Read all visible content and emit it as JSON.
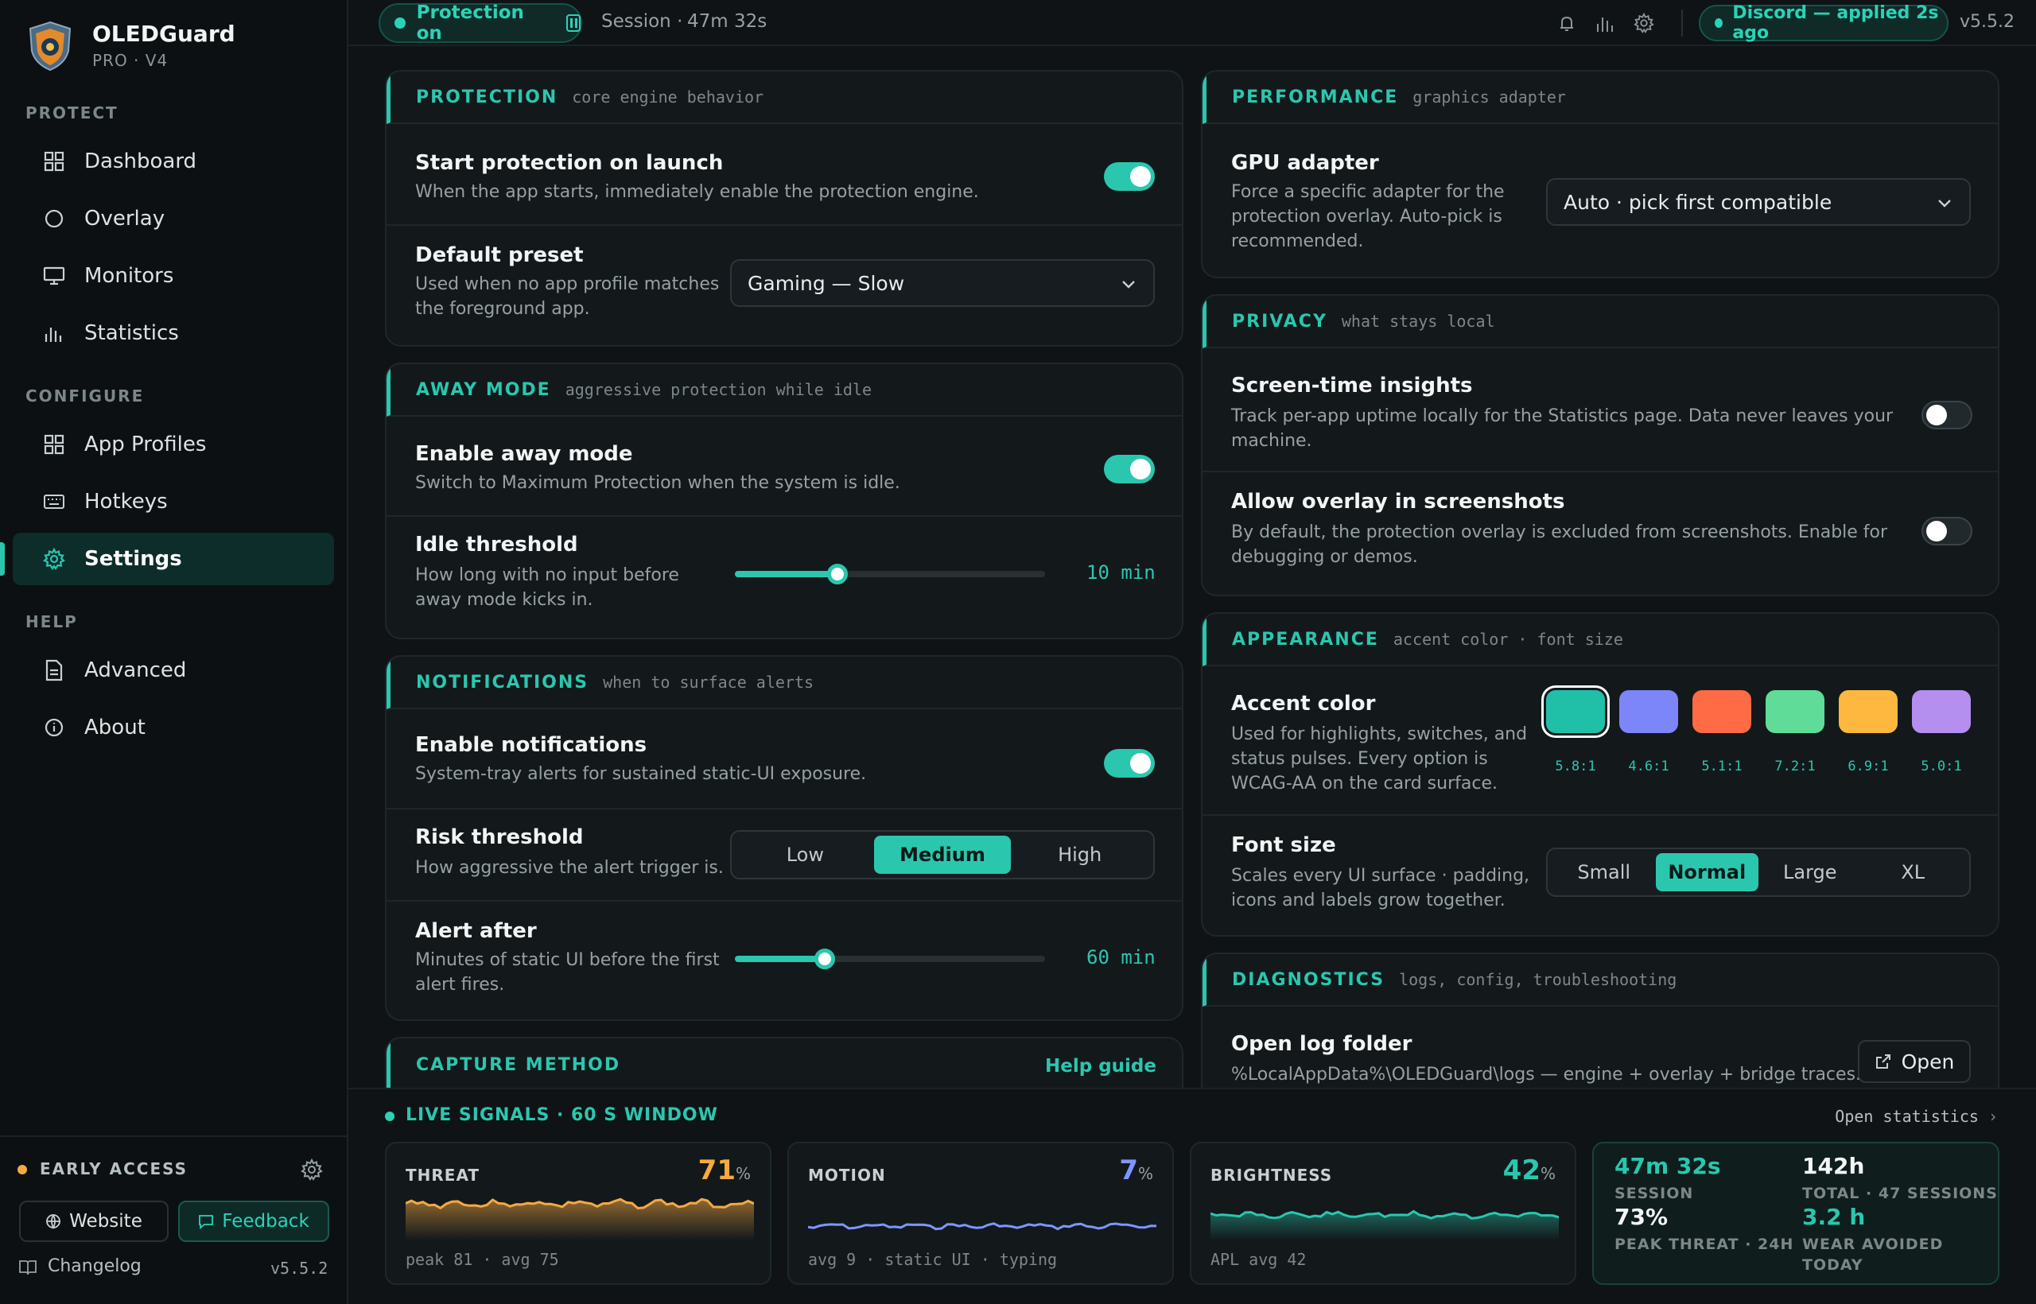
{
  "brand": {
    "name": "OLEDGuard",
    "sub": "PRO · V4"
  },
  "sidebar": {
    "sections": [
      "PROTECT",
      "CONFIGURE",
      "HELP"
    ],
    "items": [
      {
        "label": "Dashboard",
        "icon": "grid-icon"
      },
      {
        "label": "Overlay",
        "icon": "circle-icon"
      },
      {
        "label": "Monitors",
        "icon": "monitor-icon"
      },
      {
        "label": "Statistics",
        "icon": "bar-chart-icon"
      },
      {
        "label": "App Profiles",
        "icon": "grid-icon"
      },
      {
        "label": "Hotkeys",
        "icon": "keyboard-icon"
      },
      {
        "label": "Settings",
        "icon": "gear-icon",
        "active": true
      },
      {
        "label": "Advanced",
        "icon": "document-icon"
      },
      {
        "label": "About",
        "icon": "info-icon"
      }
    ],
    "early_access": "EARLY ACCESS",
    "website": "Website",
    "feedback": "Feedback",
    "changelog": "Changelog",
    "version": "v5.5.2"
  },
  "topbar": {
    "protection": "Protection on",
    "session_label": "Session ·",
    "session_time": "47m 32s",
    "profile_status": "Discord — applied 2s ago",
    "version": "v5.5.2"
  },
  "cards": {
    "protection": {
      "title": "PROTECTION",
      "sub": "core engine behavior",
      "launch_title": "Start protection on launch",
      "launch_desc": "When the app starts, immediately enable the protection engine.",
      "launch_on": true,
      "preset_title": "Default preset",
      "preset_desc1": "Used when no app profile matches",
      "preset_desc2": "the foreground app.",
      "preset_value": "Gaming — Slow"
    },
    "away": {
      "title": "AWAY MODE",
      "sub": "aggressive protection while idle",
      "enable_title": "Enable away mode",
      "enable_desc": "Switch to Maximum Protection when the system is idle.",
      "enable_on": true,
      "idle_title": "Idle threshold",
      "idle_desc1": "How long with no input before",
      "idle_desc2": "away mode kicks in.",
      "idle_value": "10 min",
      "idle_fraction": 0.33
    },
    "notifications": {
      "title": "NOTIFICATIONS",
      "sub": "when to surface alerts",
      "enable_title": "Enable notifications",
      "enable_desc": "System-tray alerts for sustained static-UI exposure.",
      "enable_on": true,
      "risk_title": "Risk threshold",
      "risk_desc": "How aggressive the alert trigger is.",
      "risk_options": [
        "Low",
        "Medium",
        "High"
      ],
      "risk_selected": "Medium",
      "alert_title": "Alert after",
      "alert_desc1": "Minutes of static UI before the first",
      "alert_desc2": "alert fires.",
      "alert_value": "60 min",
      "alert_fraction": 0.29
    },
    "capture": {
      "title": "CAPTURE METHOD",
      "help": "Help guide"
    },
    "performance": {
      "title": "PERFORMANCE",
      "sub": "graphics adapter",
      "gpu_title": "GPU adapter",
      "gpu_desc1": "Force a specific adapter for the",
      "gpu_desc2": "protection overlay. Auto-pick is",
      "gpu_desc3": "recommended.",
      "gpu_value": "Auto · pick first compatible"
    },
    "privacy": {
      "title": "PRIVACY",
      "sub": "what stays local",
      "insights_title": "Screen-time insights",
      "insights_desc1": "Track per-app uptime locally for the Statistics page. Data never leaves your",
      "insights_desc2": "machine.",
      "insights_on": false,
      "shots_title": "Allow overlay in screenshots",
      "shots_desc1": "By default, the protection overlay is excluded from screenshots. Enable for",
      "shots_desc2": "debugging or demos.",
      "shots_on": false
    },
    "appearance": {
      "title": "APPEARANCE",
      "sub": "accent color · font size",
      "accent_title": "Accent color",
      "accent_desc1": "Used for highlights, switches, and",
      "accent_desc2": "status pulses. Every option is",
      "accent_desc3": "WCAG-AA on the card surface.",
      "swatches": [
        {
          "color": "#1fbfa8",
          "ratio": "5.8:1",
          "selected": true
        },
        {
          "color": "#7c86f8",
          "ratio": "4.6:1"
        },
        {
          "color": "#ff6b45",
          "ratio": "5.1:1"
        },
        {
          "color": "#5fdc98",
          "ratio": "7.2:1"
        },
        {
          "color": "#ffb83f",
          "ratio": "6.9:1"
        },
        {
          "color": "#b48ff0",
          "ratio": "5.0:1"
        }
      ],
      "font_title": "Font size",
      "font_desc1": "Scales every UI surface · padding,",
      "font_desc2": "icons and labels grow together.",
      "font_options": [
        "Small",
        "Normal",
        "Large",
        "XL"
      ],
      "font_selected": "Normal"
    },
    "diagnostics": {
      "title": "DIAGNOSTICS",
      "sub": "logs, config, troubleshooting",
      "log_title": "Open log folder",
      "log_desc": "%LocalAppData%\\OLEDGuard\\logs — engine + overlay + bridge traces.",
      "open_label": "Open"
    }
  },
  "live": {
    "title": "LIVE SIGNALS · 60 S WINDOW",
    "open_stats": "Open statistics",
    "threat": {
      "name": "THREAT",
      "value": "71",
      "unit": "%",
      "foot": "peak 81 · avg 75",
      "color": "#f5a940"
    },
    "motion": {
      "name": "MOTION",
      "value": "7",
      "unit": "%",
      "foot": "avg 9 · static UI · typing",
      "color": "#7d96ff"
    },
    "brightness": {
      "name": "BRIGHTNESS",
      "value": "42",
      "unit": "%",
      "foot": "APL avg 42",
      "color": "#2ac7ae"
    },
    "stats": {
      "session_value": "47m 32s",
      "session_label": "SESSION",
      "total_value": "142h",
      "total_label": "TOTAL · 47 SESSIONS",
      "peak_value": "73%",
      "peak_label": "PEAK THREAT · 24H",
      "wear_value": "3.2 h",
      "wear_label1": "WEAR AVOIDED",
      "wear_label2": "TODAY"
    }
  }
}
